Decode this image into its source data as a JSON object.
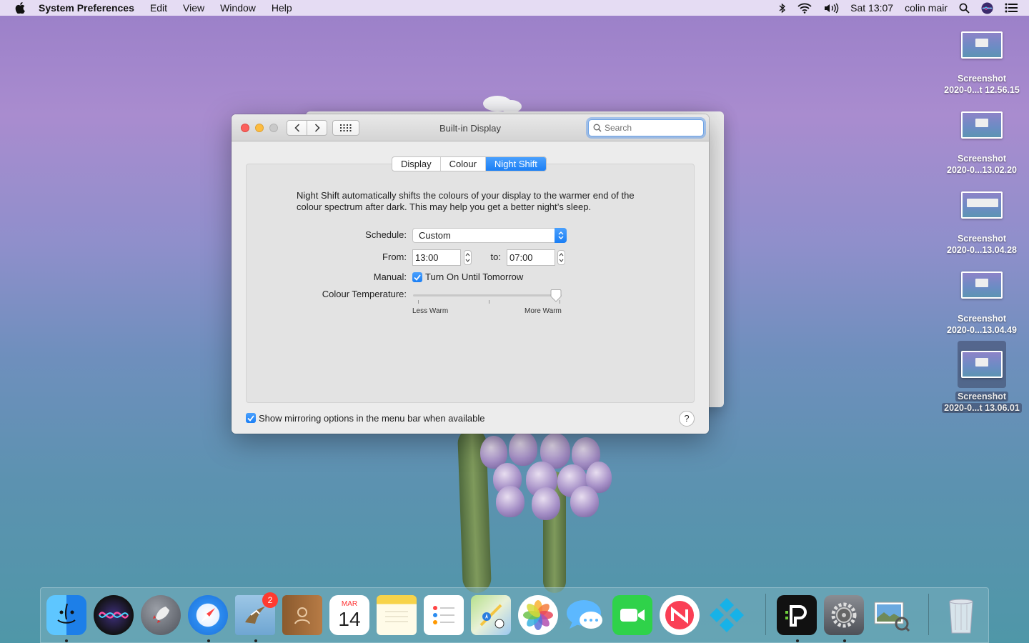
{
  "menubar": {
    "app_name": "System Preferences",
    "menus": [
      "Edit",
      "View",
      "Window",
      "Help"
    ],
    "clock": "Sat 13:07",
    "user": "colin mair"
  },
  "desktop_icons": [
    {
      "line1": "Screenshot",
      "line2": "2020-0...t 12.56.15"
    },
    {
      "line1": "Screenshot",
      "line2": "2020-0...13.02.20"
    },
    {
      "line1": "Screenshot",
      "line2": "2020-0...13.04.28"
    },
    {
      "line1": "Screenshot",
      "line2": "2020-0...13.04.49"
    },
    {
      "line1": "Screenshot",
      "line2": "2020-0...t 13.06.01"
    }
  ],
  "window": {
    "title": "Built-in Display",
    "search_placeholder": "Search",
    "tabs": [
      "Display",
      "Colour",
      "Night Shift"
    ],
    "active_tab": "Night Shift",
    "description": "Night Shift automatically shifts the colours of your display to the warmer end of the colour spectrum after dark. This may help you get a better night’s sleep.",
    "schedule_label": "Schedule:",
    "schedule_value": "Custom",
    "from_label": "From:",
    "from_value": "13:00",
    "to_label": "to:",
    "to_value": "07:00",
    "manual_label": "Manual:",
    "manual_checkbox_label": "Turn On Until Tomorrow",
    "manual_checked": true,
    "temperature_label": "Colour Temperature:",
    "temperature_min_label": "Less Warm",
    "temperature_max_label": "More Warm",
    "temperature_level": 1.0,
    "mirroring_label": "Show mirroring options in the menu bar when available",
    "mirroring_checked": true,
    "help_label": "?"
  },
  "dock": {
    "items": [
      "finder-icon",
      "siri-icon",
      "launchpad-icon",
      "safari-icon",
      "mail-icon",
      "contacts-icon",
      "calendar-icon",
      "notes-icon",
      "reminders-icon",
      "maps-icon",
      "photos-icon",
      "messages-icon",
      "facetime-icon",
      "news-icon",
      "kodi-icon",
      "ipvanish-icon",
      "system-preferences-icon",
      "preview-icon",
      "trash-icon"
    ],
    "mail_badge": "2",
    "calendar_month": "MAR",
    "calendar_day": "14"
  },
  "colors": {
    "accent": "#1b7ff5",
    "close": "#fc605c",
    "minimize": "#fdbc40"
  }
}
